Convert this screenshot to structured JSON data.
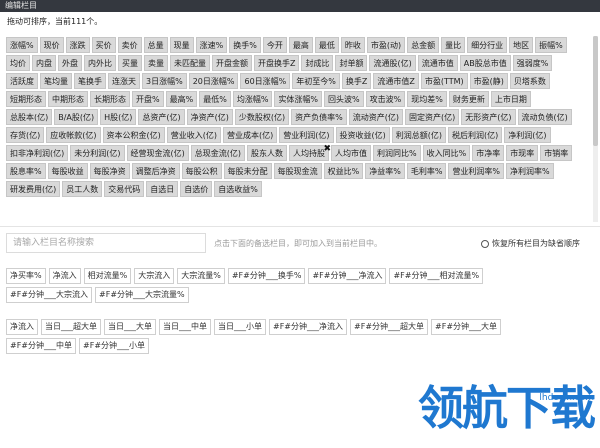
{
  "window": {
    "title": "编辑栏目"
  },
  "hint": {
    "text": "拖动可排序，当前111个。"
  },
  "selected_tags": [
    "涨幅%",
    "现价",
    "涨跌",
    "买价",
    "卖价",
    "总量",
    "现量",
    "涨速%",
    "换手%",
    "今开",
    "最高",
    "最低",
    "昨收",
    "市盈(动)",
    "总金额",
    "量比",
    "细分行业",
    "地区",
    "振幅%",
    "均价",
    "内盘",
    "外盘",
    "内外比",
    "买量",
    "卖量",
    "未匹配量",
    "开盘金额",
    "开盘换手Z",
    "封成比",
    "封单额",
    "流通股(亿)",
    "流通市值",
    "AB股总市值",
    "强弱度%",
    "活跃度",
    "笔均量",
    "笔换手",
    "连涨天",
    "3日涨幅%",
    "20日涨幅%",
    "60日涨幅%",
    "年初至今%",
    "换手Z",
    "流通市值Z",
    "市盈(TTM)",
    "市盈(静)",
    "贝塔系数",
    "短期形态",
    "中期形态",
    "长期形态",
    "开盘%",
    "最高%",
    "最低%",
    "均涨幅%",
    "实体涨幅%",
    "回头波%",
    "攻击波%",
    "现均差%",
    "财务更新",
    "上市日期",
    "总股本(亿)",
    "B/A股(亿)",
    "H股(亿)",
    "总资产(亿)",
    "净资产(亿)",
    "少数股权(亿)",
    "资产负债率%",
    "流动资产(亿)",
    "固定资产(亿)",
    "无形资产(亿)",
    "流动负债(亿)",
    "存货(亿)",
    "应收帐款(亿)",
    "资本公积金(亿)",
    "营业收入(亿)",
    "营业成本(亿)",
    "营业利润(亿)",
    "投资收益(亿)",
    "利润总额(亿)",
    "税后利润(亿)",
    "净利润(亿)",
    "扣非净利润(亿)",
    "未分利润(亿)",
    "经营现金流(亿)",
    "总现金流(亿)",
    "股东人数",
    "人均持股",
    "人均市值",
    "利润同比%",
    "收入同比%",
    "市净率",
    "市现率",
    "市销率",
    "股息率%",
    "每股收益",
    "每股净资",
    "调整后净资",
    "每股公积",
    "每股未分配",
    "每股现金流",
    "权益比%",
    "净益率%",
    "毛利率%",
    "营业利润率%",
    "净利润率%",
    "研发费用(亿)",
    "员工人数",
    "交易代码",
    "自选日",
    "自选价",
    "自选收益%"
  ],
  "search": {
    "placeholder": "请输入栏目名称搜索"
  },
  "tip": "点击下面的备选栏目，即可加入到当前栏目中。",
  "reset_label": "恢复所有栏目为缺省顺序",
  "options_group1": [
    "净买率%",
    "净流入",
    "相对流量%",
    "大宗流入",
    "大宗流量%",
    "#F#分钟___换手%",
    "#F#分钟___净流入",
    "#F#分钟___相对流量%",
    "#F#分钟___大宗流入",
    "#F#分钟___大宗流量%"
  ],
  "options_group2": [
    "净流入",
    "当日___超大单",
    "当日___大单",
    "当日___中单",
    "当日___小单",
    "#F#分钟___净流入",
    "#F#分钟___超大单",
    "#F#分钟___大单",
    "#F#分钟___中单",
    "#F#分钟___小单"
  ],
  "watermark": {
    "text": "领航下载",
    "url": "lhdown.com"
  }
}
